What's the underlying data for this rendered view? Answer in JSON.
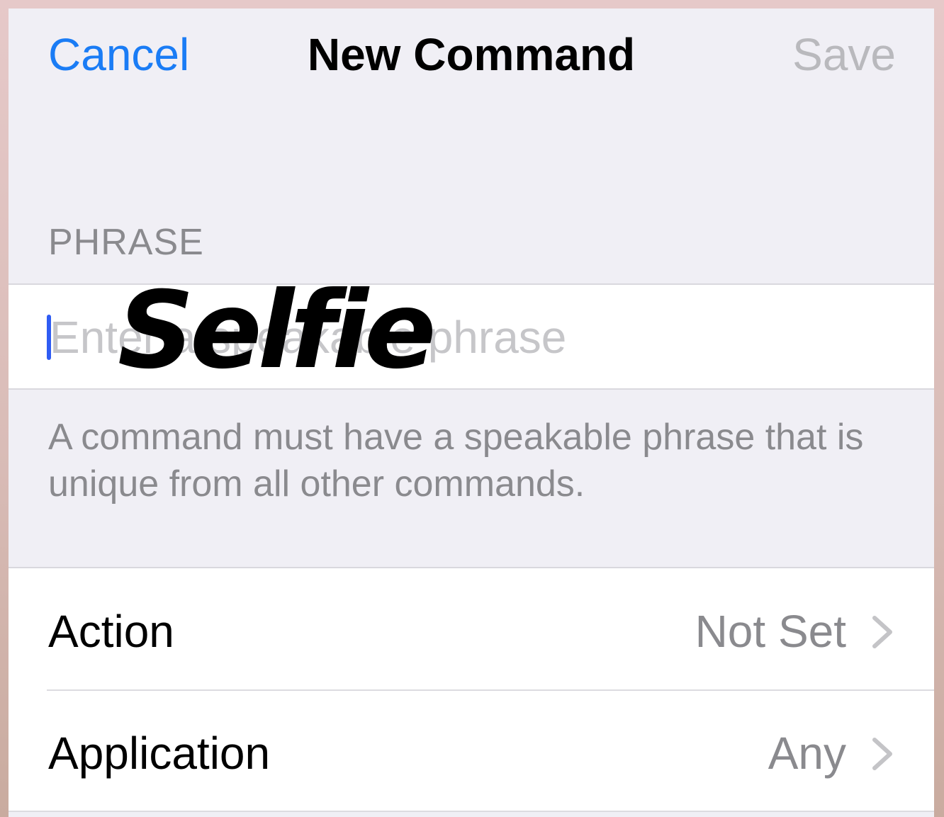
{
  "nav": {
    "cancel_label": "Cancel",
    "title": "New Command",
    "save_label": "Save"
  },
  "phrase_section": {
    "header": "PHRASE",
    "input_value": "",
    "input_placeholder": "Enter a speakable phrase",
    "overlay_text": "Selfie",
    "footer": "A command must have a speakable phrase that is unique from all other commands."
  },
  "settings": {
    "rows": [
      {
        "label": "Action",
        "value": "Not Set",
        "icon": "chevron-right-icon"
      },
      {
        "label": "Application",
        "value": "Any",
        "icon": "chevron-right-icon"
      }
    ]
  },
  "colors": {
    "accent": "#1a7cf5",
    "caret": "#2f5cf3",
    "disabled": "#b9b9bd",
    "secondary_text": "#8a8a8e",
    "group_background": "#f0eff5"
  }
}
